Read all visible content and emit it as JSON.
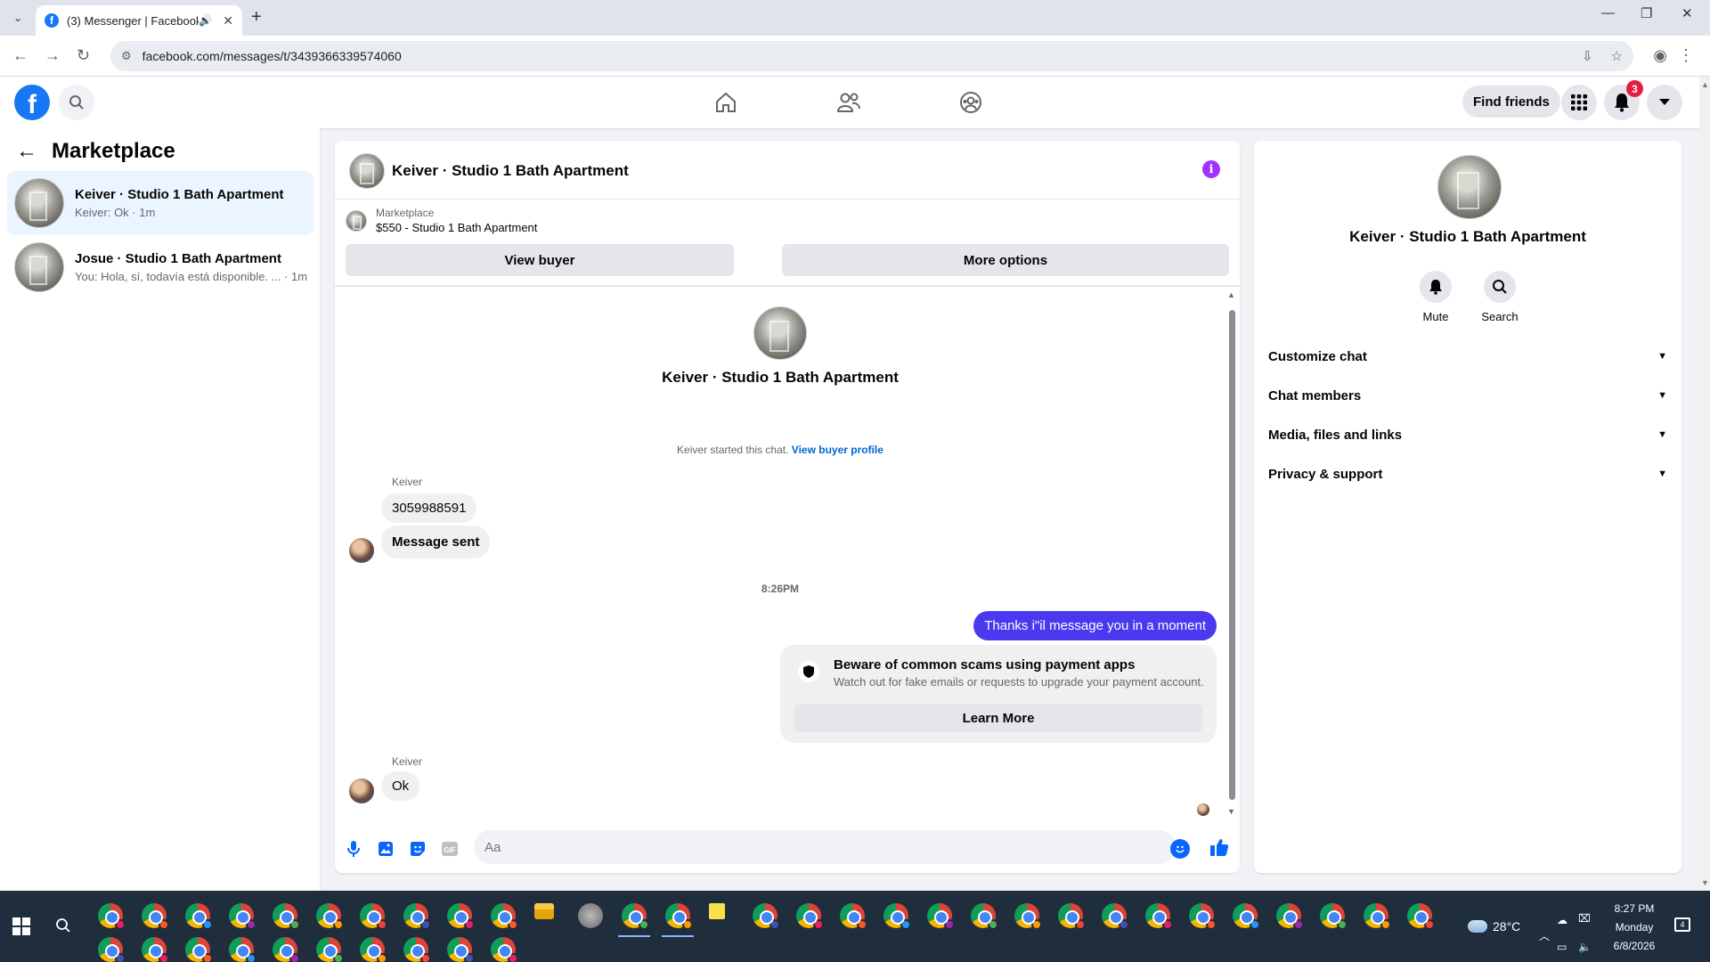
{
  "browser": {
    "tab_title": "(3) Messenger | Facebook",
    "url": "facebook.com/messages/t/3439366339574060",
    "new_tab": "+"
  },
  "fb": {
    "logo": "f",
    "find_friends": "Find friends",
    "notification_count": "3",
    "brand_color": "#1877f2"
  },
  "sidebar": {
    "title": "Marketplace",
    "conversations": [
      {
        "name": "Keiver · Studio 1 Bath Apartment",
        "preview": "Keiver: Ok · 1m",
        "active": true
      },
      {
        "name": "Josue · Studio 1 Bath Apartment",
        "preview": "You: Hola, sí, todavía está disponible. ... · 1m",
        "active": false
      }
    ]
  },
  "chat": {
    "header_name": "Keiver · Studio 1 Bath Apartment",
    "listing_source": "Marketplace",
    "listing_title": "$550 - Studio 1 Bath Apartment",
    "view_buyer": "View buyer",
    "more_options": "More options",
    "intro_name": "Keiver · Studio 1 Bath Apartment",
    "started_text": "Keiver started this chat.",
    "view_buyer_profile": "View buyer profile",
    "messages": [
      {
        "sender": "Keiver",
        "texts": [
          "3059988591",
          "Message sent"
        ]
      },
      {
        "timestamp": "8:26PM"
      },
      {
        "mine": "Thanks i\"il message you in a moment"
      },
      {
        "sender": "Keiver",
        "texts": [
          "Ok"
        ]
      }
    ],
    "scam_notice": {
      "title": "Beware of common scams using payment apps",
      "body": "Watch out for fake emails or requests to upgrade your payment account.",
      "button": "Learn More"
    },
    "composer_placeholder": "Aa",
    "outgoing_color": "#4b39ef"
  },
  "details": {
    "name": "Keiver · Studio 1 Bath Apartment",
    "actions": [
      "Mute",
      "Search"
    ],
    "sections": [
      "Customize chat",
      "Chat members",
      "Media, files and links",
      "Privacy & support"
    ]
  },
  "taskbar": {
    "weather": "28°C",
    "time": "8:27 PM",
    "day": "Monday",
    "date": "6/8/2026",
    "notifications": "4"
  }
}
